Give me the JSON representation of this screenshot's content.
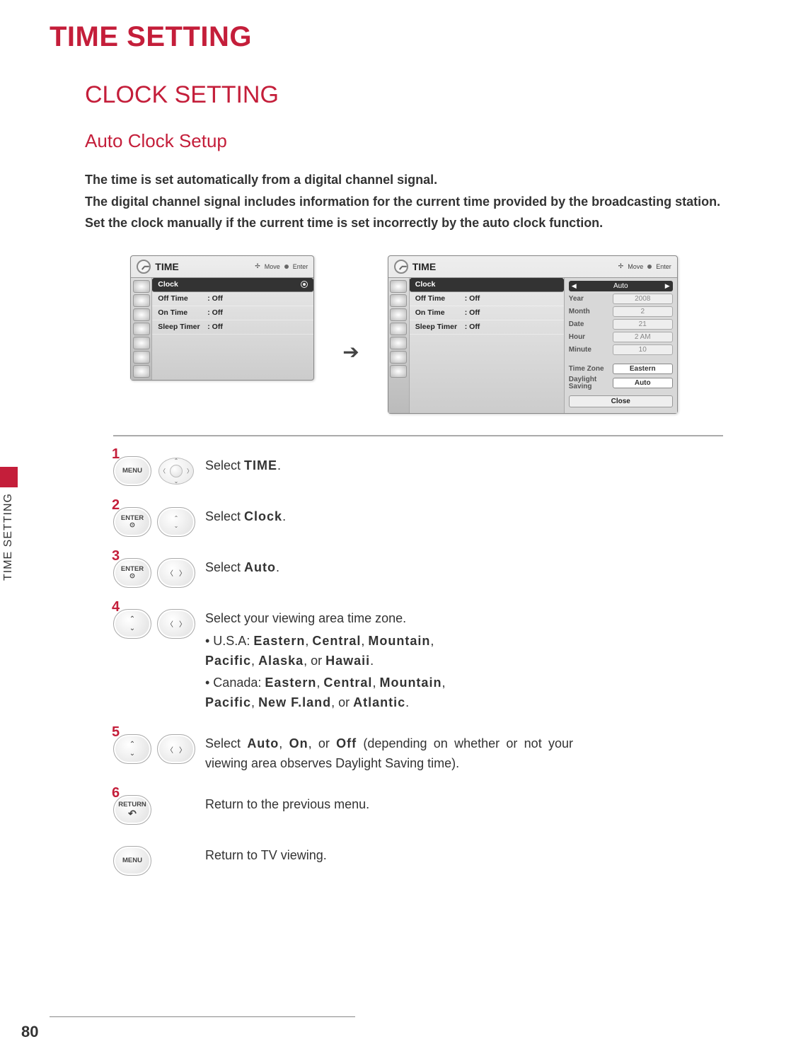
{
  "page_title": "TIME SETTING",
  "section_title": "CLOCK SETTING",
  "subsection_title": "Auto Clock Setup",
  "intro": {
    "l1": "The time is set automatically from a digital channel signal.",
    "l2": "The digital channel signal includes information for the current time provided by the broadcasting station.",
    "l3": "Set the clock manually if the current time is set incorrectly by the auto clock function."
  },
  "osd1": {
    "title": "TIME",
    "hint_move": "Move",
    "hint_enter": "Enter",
    "rows": [
      {
        "label": "Clock",
        "value": "",
        "selected": true
      },
      {
        "label": "Off Time",
        "value": ": Off"
      },
      {
        "label": "On Time",
        "value": ": Off"
      },
      {
        "label": "Sleep Timer",
        "value": ": Off"
      }
    ]
  },
  "osd2": {
    "title": "TIME",
    "hint_move": "Move",
    "hint_enter": "Enter",
    "rows": [
      {
        "label": "Clock",
        "value": "",
        "selected": true
      },
      {
        "label": "Off Time",
        "value": ": Off"
      },
      {
        "label": "On Time",
        "value": ": Off"
      },
      {
        "label": "Sleep Timer",
        "value": ": Off"
      }
    ],
    "side": {
      "auto_label": "Auto",
      "year_label": "Year",
      "year": "2008",
      "month_label": "Month",
      "month": "2",
      "date_label": "Date",
      "date": "21",
      "hour_label": "Hour",
      "hour": "2 AM",
      "minute_label": "Minute",
      "minute": "10",
      "tz_label": "Time Zone",
      "tz": "Eastern",
      "ds_label1": "Daylight",
      "ds_label2": "Saving",
      "ds": "Auto",
      "close": "Close"
    }
  },
  "steps": {
    "s1": {
      "num": "1",
      "btn": "MENU",
      "pre": "Select ",
      "opt": "TIME",
      "post": "."
    },
    "s2": {
      "num": "2",
      "btn": "ENTER",
      "pre": "Select ",
      "opt": "Clock",
      "post": "."
    },
    "s3": {
      "num": "3",
      "btn": "ENTER",
      "pre": "Select ",
      "opt": "Auto",
      "post": "."
    },
    "s4": {
      "num": "4",
      "line1": "Select your viewing area time zone.",
      "usa_pre": "• U.S.A:  ",
      "usa_opts": [
        "Eastern",
        "Central",
        "Mountain",
        "Pacific",
        "Alaska",
        "Hawaii"
      ],
      "can_pre": "• Canada:  ",
      "can_opts": [
        "Eastern",
        "Central",
        "Mountain",
        "Pacific",
        "New F.land",
        "Atlantic"
      ],
      "or": ", or ",
      "sep": ",  "
    },
    "s5": {
      "num": "5",
      "pre": "Select  ",
      "opts": [
        "Auto",
        "On",
        "Off"
      ],
      "mid": " (depending on whether or not your viewing area observes Daylight Saving time).",
      "or": ",  or  ",
      "sep": ",  "
    },
    "s6": {
      "num": "6",
      "btn": "RETURN",
      "text": "Return to the previous menu."
    },
    "s7": {
      "btn": "MENU",
      "text": "Return to TV viewing."
    }
  },
  "side_tab": "TIME SETTING",
  "page_number": "80"
}
